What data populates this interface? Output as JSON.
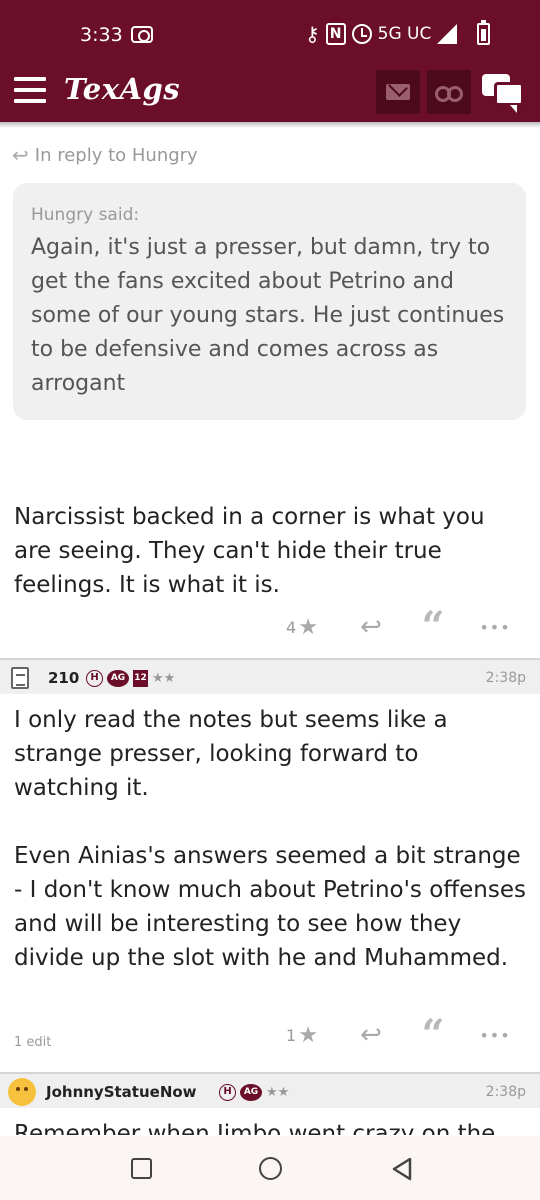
{
  "status_bar": {
    "time": "3:33",
    "network": "5G UC",
    "icons": [
      "screen-record-icon",
      "key-icon",
      "nfc-icon",
      "alarm-icon",
      "signal-icon",
      "battery-charging-icon"
    ]
  },
  "header": {
    "logo": "TexAgs",
    "icons": [
      "menu-icon",
      "mail-icon",
      "binoculars-icon",
      "chat-bubbles-icon"
    ]
  },
  "post1": {
    "reply_to": "In reply to Hungry",
    "quote_author": "Hungry said:",
    "quote_text": "Again, it's just a presser, but damn, try to get the fans excited about Petrino and some of our young stars. He just continues to be defensive and comes across as arrogant",
    "body": "Narcissist backed in a corner is what you are seeing. They can't hide their true feelings. It is what it is.",
    "rating": "4"
  },
  "post2": {
    "username": "210",
    "badges": {
      "h": "H",
      "ag": "AG",
      "years": "12",
      "stars": "★★"
    },
    "time": "2:38p",
    "paragraph1": "I only read the notes but seems like a strange presser, looking forward to watching it.",
    "paragraph2": "Even Ainias's answers seemed a bit strange - I don't know much about Petrino's offenses and will be interesting to see how they divide up the slot with he and Muhammed.",
    "edits": "1 edit",
    "rating": "1"
  },
  "post3": {
    "username": "JohnnyStatueNow",
    "badges": {
      "h": "H",
      "ag": "AG",
      "stars": "★★"
    },
    "time": "2:38p",
    "body_clipped": "Remember when Jimbo went crazy on the"
  },
  "actions": {
    "star": "★",
    "reply": "↩",
    "quote": "“",
    "more": "•••"
  },
  "colors": {
    "maroon": "#6a0e2a",
    "header_dark": "#4d0a1e",
    "quote_bg": "#f0f0f0",
    "post_header_bg": "#efefef"
  }
}
